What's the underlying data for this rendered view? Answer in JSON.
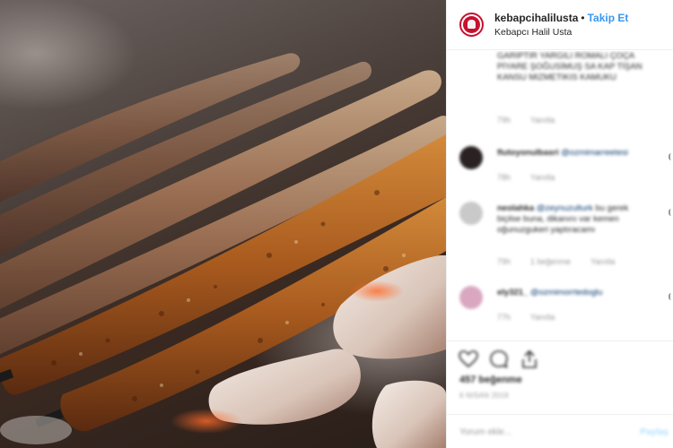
{
  "post": {
    "username": "kebapcihalilusta",
    "separator": "•",
    "follow_label": "Takip Et",
    "location": "Kebapcı Halil Usta"
  },
  "comments": {
    "first_text": "GARIPTIR YARGILI ROMALI ÇOÇA PİYARE ŞOĞUSİMUŞ SA KAP TİŞAN KANSU MIZMETIKIS KAMUKU",
    "first_time": "79h",
    "first_reply": "Yanıtla",
    "c1_user": "flutoyonulbasri",
    "c1_mention": "@ozmimarreetesi",
    "c1_time": "78h",
    "c1_reply": "Yanıtla",
    "c2_user": "neolahka",
    "c2_mention": "@zeynuzulturk",
    "c2_text": "bu gerek biçilse buna, dikanını var kemen oğunuzgukeri yaptıracamı",
    "c2_time": "79h",
    "c2_likes": "1 beğenme",
    "c2_reply": "Yanıtla",
    "c3_user": "ely321_",
    "c3_mention": "@ozmimorrtedoglu",
    "c3_time": "77h",
    "c3_reply": "Yanıtla"
  },
  "actions": {
    "icons": [
      "heart-icon",
      "comment-icon",
      "share-icon"
    ],
    "likes": "457 beğenme",
    "date": "6 NISAN 2019"
  },
  "composer": {
    "placeholder": "Yorum ekle...",
    "post_label": "Paylaş"
  },
  "colors": {
    "brand_red": "#c8102e",
    "link_blue": "#3897f0",
    "muted": "#999999"
  }
}
